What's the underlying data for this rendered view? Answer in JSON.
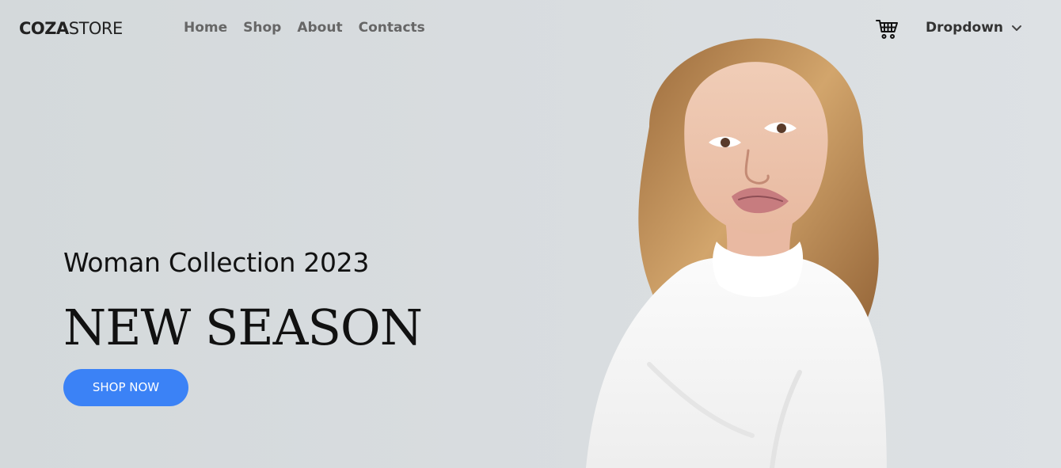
{
  "header": {
    "logo_bold": "COZA",
    "logo_light": "STORE",
    "nav": [
      "Home",
      "Shop",
      "About",
      "Contacts"
    ],
    "cart_icon": "shopping-cart-icon",
    "dropdown_label": "Dropdown",
    "dropdown_icon": "chevron-down-icon"
  },
  "hero": {
    "subtitle": "Woman Collection 2023",
    "title": "NEW SEASON",
    "cta_label": "SHOP NOW",
    "image_semantic": "model-photo",
    "accent_color": "#3b82f6"
  }
}
